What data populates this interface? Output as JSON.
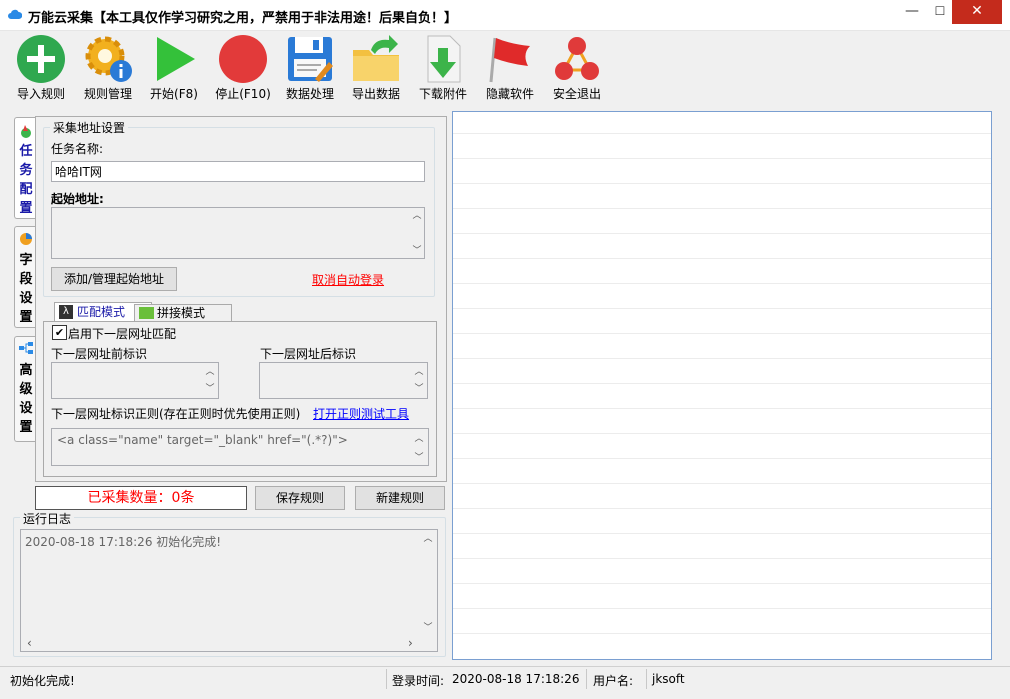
{
  "window": {
    "title": "万能云采集【本工具仅作学习研究之用，严禁用于非法用途！后果自负！】"
  },
  "window_controls": {
    "minimize": "—",
    "maximize": "☐",
    "close": "✕"
  },
  "toolbar": [
    {
      "label": "导入规则",
      "icon": "add-circle-icon"
    },
    {
      "label": "规则管理",
      "icon": "gear-info-icon"
    },
    {
      "label": "开始(F8)",
      "icon": "play-icon"
    },
    {
      "label": "停止(F10)",
      "icon": "stop-icon"
    },
    {
      "label": "数据处理",
      "icon": "floppy-icon"
    },
    {
      "label": "导出数据",
      "icon": "folder-export-icon"
    },
    {
      "label": "下载附件",
      "icon": "download-icon"
    },
    {
      "label": "隐藏软件",
      "icon": "red-flag-icon"
    },
    {
      "label": "安全退出",
      "icon": "exit-nodes-icon"
    }
  ],
  "side_tabs": [
    {
      "label": "任务配置",
      "icon": "task-icon"
    },
    {
      "label": "字段设置",
      "icon": "field-icon"
    },
    {
      "label": "高级设置",
      "icon": "advanced-icon"
    }
  ],
  "collect": {
    "group_title": "采集地址设置",
    "task_name_label": "任务名称:",
    "task_name_value": "哈哈IT网",
    "start_url_label": "起始地址:",
    "start_url_value": "",
    "add_url_button": "添加/管理起始地址",
    "cancel_login_link": "取消自动登录"
  },
  "match_tabs": {
    "tab1": "匹配模式",
    "tab2": "拼接模式"
  },
  "match": {
    "enable_checkbox": "启用下一层网址匹配",
    "enabled": true,
    "prefix_label": "下一层网址前标识",
    "suffix_label": "下一层网址后标识",
    "regex_label": "下一层网址标识正则(存在正则时优先使用正则)",
    "regex_tool_link": "打开正则测试工具",
    "regex_value": "<a class=\"name\" target=\"_blank\" href=\"(.*?)\">"
  },
  "count": {
    "text": "已采集数量：0条"
  },
  "actions": {
    "save": "保存规则",
    "new": "新建规则"
  },
  "log": {
    "title": "运行日志",
    "entry": "2020-08-18 17:18:26 初始化完成!"
  },
  "status": {
    "message": "初始化完成!",
    "login_time_label": "登录时间:",
    "login_time_value": "2020-08-18 17:18:26",
    "username_label": "用户名:",
    "username_value": "jksoft"
  },
  "colors": {
    "accent_red": "#ff0000",
    "link_blue": "#0000ff",
    "close_red": "#c42b1c",
    "panel_border": "#7a9fd1"
  }
}
